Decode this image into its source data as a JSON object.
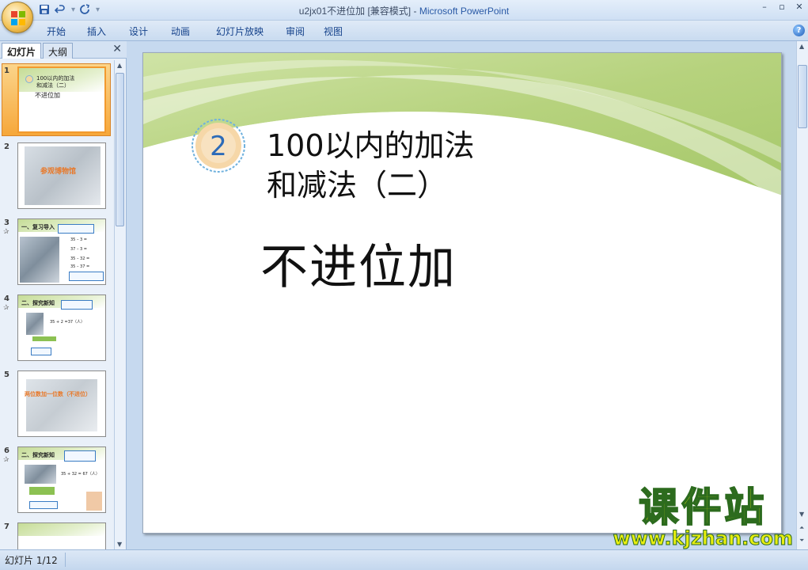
{
  "window": {
    "title_doc": "u2jx01不进位加 [兼容模式]",
    "title_sep": " - ",
    "title_app": "Microsoft PowerPoint",
    "minimize": "–",
    "restore": "▫",
    "close": "✕"
  },
  "qat": {
    "save_icon": "save-icon",
    "undo_icon": "undo-icon",
    "redo_icon": "redo-icon"
  },
  "ribbon": {
    "tabs": [
      "开始",
      "插入",
      "设计",
      "动画",
      "幻灯片放映",
      "审阅",
      "视图"
    ],
    "help": "?"
  },
  "left_pane": {
    "tab_slides": "幻灯片",
    "tab_outline": "大纲",
    "close": "✕",
    "thumbnails": [
      {
        "num": "1",
        "line1": "100以内的加法",
        "line2": "和减法（二）",
        "line3": "不进位加"
      },
      {
        "num": "2",
        "text": "参观博物馆"
      },
      {
        "num": "3",
        "heading": "一、复习导入",
        "lines": [
          "35 – 3 =",
          "37 – 3 =",
          "35 – 32 =",
          "35 – 37 ="
        ]
      },
      {
        "num": "4",
        "heading": "二、探究新知",
        "eq": "35 + 2 =37（人）"
      },
      {
        "num": "5",
        "text": "两位数加一位数（不进位）"
      },
      {
        "num": "6",
        "heading": "二、探究新知",
        "eq": "35 + 32 = 67（人）"
      },
      {
        "num": "7"
      }
    ]
  },
  "slide": {
    "badge_number": "2",
    "title_line1": "100以内的加法",
    "title_line2": "和减法（二）",
    "subtitle": "不进位加"
  },
  "watermark": {
    "title": "课件站",
    "url": "www.kjzhan.com"
  },
  "status": {
    "slide_indicator": "幻灯片 1/12"
  },
  "colors": {
    "accent_ribbon": "#c9dbf0",
    "selected_thumb": "#f6a73a",
    "slide_green": "#b8d27f",
    "watermark_yellow": "#e8ee10"
  }
}
